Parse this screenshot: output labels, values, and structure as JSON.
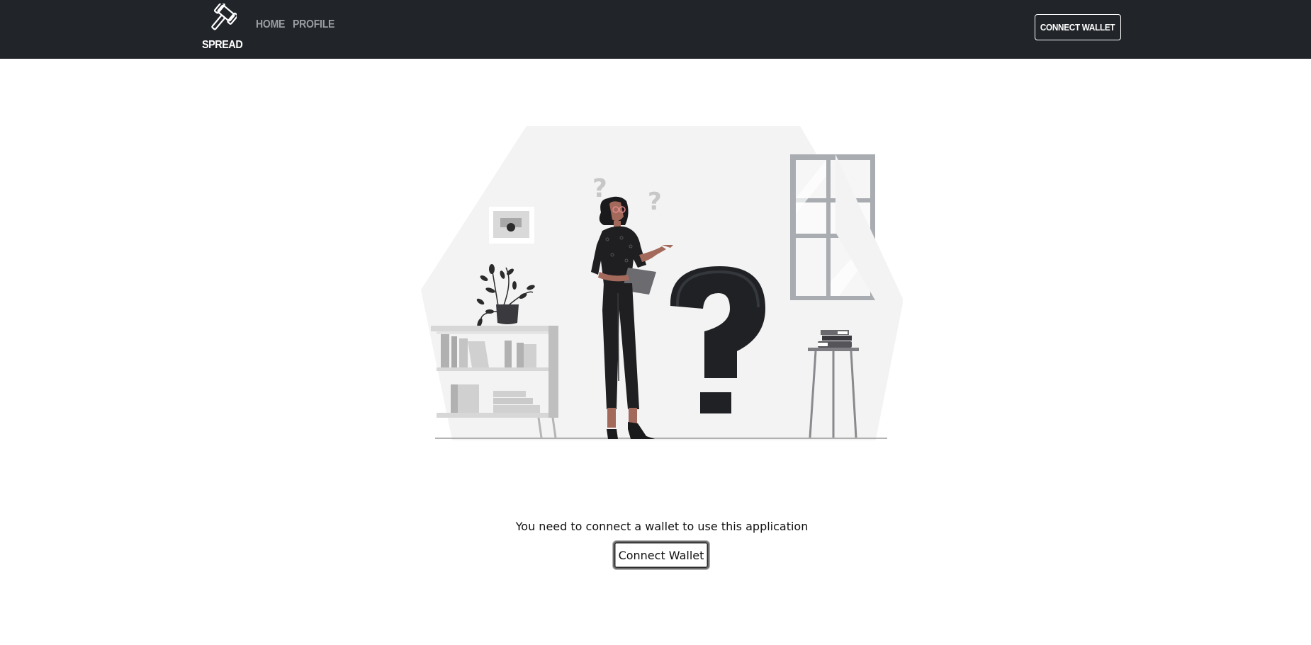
{
  "navbar": {
    "brand": "SPREAD",
    "brand_icon": "gavel-icon",
    "links": [
      {
        "label": "HOME"
      },
      {
        "label": "PROFILE"
      }
    ],
    "connect_button": "CONNECT WALLET"
  },
  "main": {
    "illustration": "woman-with-question-marks-illustration",
    "message": "You need to connect a wallet to use this application",
    "connect_button": "Connect Wallet"
  },
  "colors": {
    "navbar_bg": "#212529",
    "nav_link": "#9a9ea3",
    "page_bg": "#ffffff"
  }
}
